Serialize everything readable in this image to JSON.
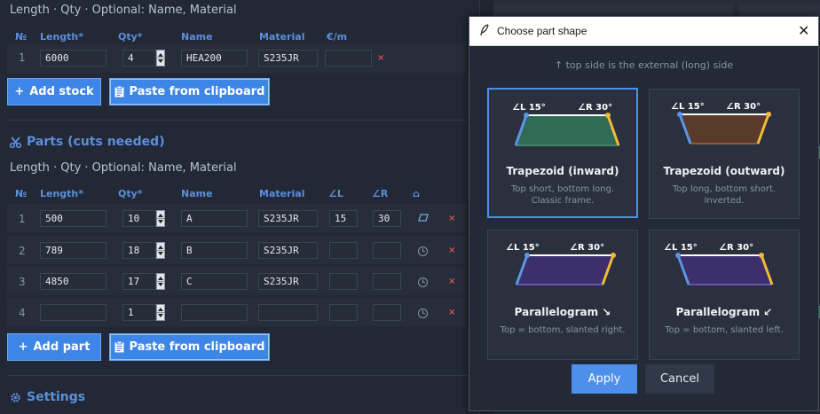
{
  "stock": {
    "hint": "Length · Qty · Optional: Name, Material",
    "headers": {
      "num": "№",
      "length": "Length*",
      "qty": "Qty*",
      "name": "Name",
      "material": "Material",
      "price": "€/m"
    },
    "rows": [
      {
        "num": "1",
        "length": "6000",
        "qty": "4",
        "name": "HEA200",
        "material": "S235JR",
        "price": "",
        "del": "×"
      }
    ],
    "add_label": "Add stock",
    "add_icon": "+",
    "paste_label": "Paste from clipboard"
  },
  "parts": {
    "title": "Parts (cuts needed)",
    "hint": "Length · Qty · Optional: Name, Material",
    "headers": {
      "num": "№",
      "length": "Length*",
      "qty": "Qty*",
      "name": "Name",
      "material": "Material",
      "angle_l": "∠L",
      "angle_r": "∠R",
      "shape": "⌂"
    },
    "rows": [
      {
        "num": "1",
        "length": "500",
        "qty": "10",
        "name": "A",
        "material": "S235JR",
        "angle_l": "15",
        "angle_r": "30",
        "shape_icon": "parallelogram-icon",
        "del": "×"
      },
      {
        "num": "2",
        "length": "789",
        "qty": "18",
        "name": "B",
        "material": "S235JR",
        "angle_l": "",
        "angle_r": "",
        "shape_icon": "clock-icon",
        "del": "×"
      },
      {
        "num": "3",
        "length": "4850",
        "qty": "17",
        "name": "C",
        "material": "S235JR",
        "angle_l": "",
        "angle_r": "",
        "shape_icon": "clock-icon",
        "del": "×"
      },
      {
        "num": "4",
        "length": "",
        "qty": "1",
        "name": "",
        "material": "",
        "angle_l": "",
        "angle_r": "",
        "shape_icon": "clock-icon",
        "del": "×"
      }
    ],
    "add_label": "Add part",
    "add_icon": "+",
    "paste_label": "Paste from clipboard"
  },
  "settings": {
    "title": "Settings"
  },
  "dialog": {
    "title": "Choose part shape",
    "hint": "↑ top side is the external (long) side",
    "angle_left": "∠L 15°",
    "angle_right": "∠R 30°",
    "cards": [
      {
        "id": "trapezoid-inward",
        "name": "Trapezoid (inward)",
        "desc1": "Top short, bottom long.",
        "desc2": "Classic frame.",
        "fill": "#2f6b55",
        "selected": true
      },
      {
        "id": "trapezoid-outward",
        "name": "Trapezoid (outward)",
        "desc1": "Top long, bottom short.",
        "desc2": "Inverted.",
        "fill": "#5a3a2a",
        "selected": false
      },
      {
        "id": "parallelogram-right",
        "name": "Parallelogram ↘",
        "desc1": "Top = bottom, slanted right.",
        "desc2": "",
        "fill": "#3c2f6b",
        "selected": false
      },
      {
        "id": "parallelogram-left",
        "name": "Parallelogram ↙",
        "desc1": "Top = bottom, slanted left.",
        "desc2": "",
        "fill": "#3c2f6b",
        "selected": false
      }
    ],
    "apply_label": "Apply",
    "cancel_label": "Cancel",
    "close_icon": "close-icon"
  },
  "colors": {
    "accent": "#3d85e6",
    "left_edge": "#5b95e8",
    "right_edge": "#f2b93b",
    "danger": "#d9534f",
    "heading": "#5b8fd9"
  }
}
